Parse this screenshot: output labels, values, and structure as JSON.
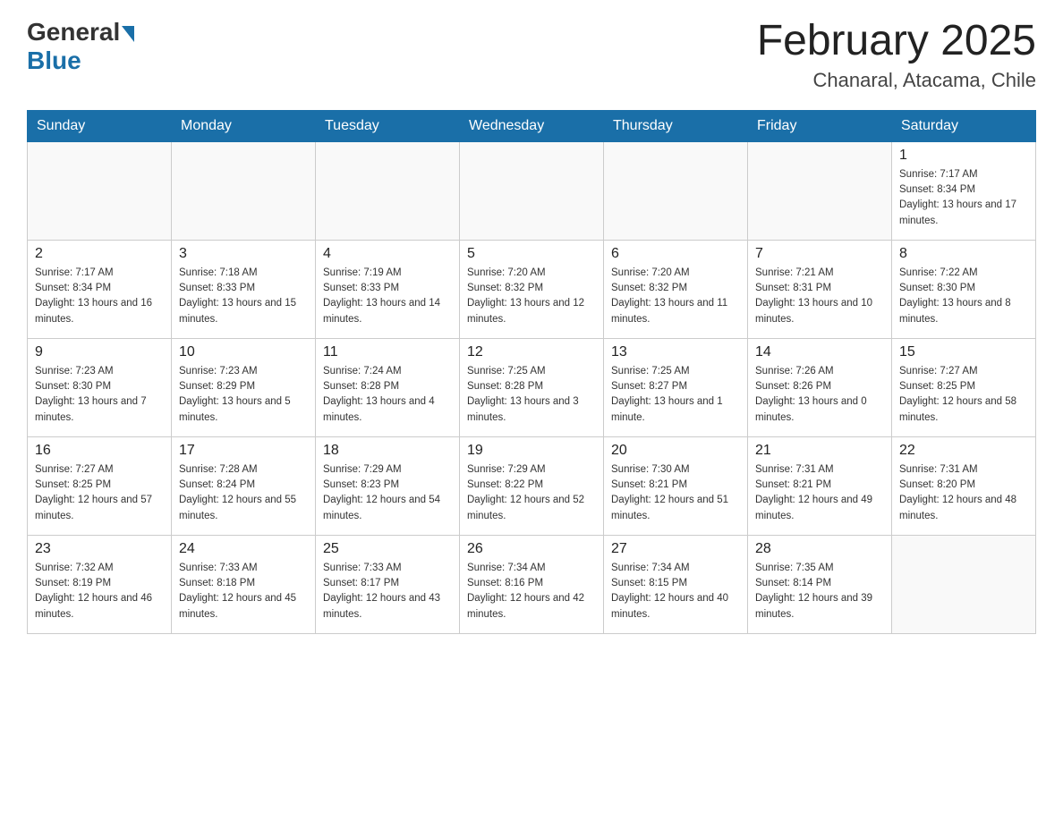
{
  "logo": {
    "general": "General",
    "blue": "Blue"
  },
  "title": "February 2025",
  "subtitle": "Chanaral, Atacama, Chile",
  "days_of_week": [
    "Sunday",
    "Monday",
    "Tuesday",
    "Wednesday",
    "Thursday",
    "Friday",
    "Saturday"
  ],
  "weeks": [
    [
      {
        "day": "",
        "sunrise": "",
        "sunset": "",
        "daylight": ""
      },
      {
        "day": "",
        "sunrise": "",
        "sunset": "",
        "daylight": ""
      },
      {
        "day": "",
        "sunrise": "",
        "sunset": "",
        "daylight": ""
      },
      {
        "day": "",
        "sunrise": "",
        "sunset": "",
        "daylight": ""
      },
      {
        "day": "",
        "sunrise": "",
        "sunset": "",
        "daylight": ""
      },
      {
        "day": "",
        "sunrise": "",
        "sunset": "",
        "daylight": ""
      },
      {
        "day": "1",
        "sunrise": "Sunrise: 7:17 AM",
        "sunset": "Sunset: 8:34 PM",
        "daylight": "Daylight: 13 hours and 17 minutes."
      }
    ],
    [
      {
        "day": "2",
        "sunrise": "Sunrise: 7:17 AM",
        "sunset": "Sunset: 8:34 PM",
        "daylight": "Daylight: 13 hours and 16 minutes."
      },
      {
        "day": "3",
        "sunrise": "Sunrise: 7:18 AM",
        "sunset": "Sunset: 8:33 PM",
        "daylight": "Daylight: 13 hours and 15 minutes."
      },
      {
        "day": "4",
        "sunrise": "Sunrise: 7:19 AM",
        "sunset": "Sunset: 8:33 PM",
        "daylight": "Daylight: 13 hours and 14 minutes."
      },
      {
        "day": "5",
        "sunrise": "Sunrise: 7:20 AM",
        "sunset": "Sunset: 8:32 PM",
        "daylight": "Daylight: 13 hours and 12 minutes."
      },
      {
        "day": "6",
        "sunrise": "Sunrise: 7:20 AM",
        "sunset": "Sunset: 8:32 PM",
        "daylight": "Daylight: 13 hours and 11 minutes."
      },
      {
        "day": "7",
        "sunrise": "Sunrise: 7:21 AM",
        "sunset": "Sunset: 8:31 PM",
        "daylight": "Daylight: 13 hours and 10 minutes."
      },
      {
        "day": "8",
        "sunrise": "Sunrise: 7:22 AM",
        "sunset": "Sunset: 8:30 PM",
        "daylight": "Daylight: 13 hours and 8 minutes."
      }
    ],
    [
      {
        "day": "9",
        "sunrise": "Sunrise: 7:23 AM",
        "sunset": "Sunset: 8:30 PM",
        "daylight": "Daylight: 13 hours and 7 minutes."
      },
      {
        "day": "10",
        "sunrise": "Sunrise: 7:23 AM",
        "sunset": "Sunset: 8:29 PM",
        "daylight": "Daylight: 13 hours and 5 minutes."
      },
      {
        "day": "11",
        "sunrise": "Sunrise: 7:24 AM",
        "sunset": "Sunset: 8:28 PM",
        "daylight": "Daylight: 13 hours and 4 minutes."
      },
      {
        "day": "12",
        "sunrise": "Sunrise: 7:25 AM",
        "sunset": "Sunset: 8:28 PM",
        "daylight": "Daylight: 13 hours and 3 minutes."
      },
      {
        "day": "13",
        "sunrise": "Sunrise: 7:25 AM",
        "sunset": "Sunset: 8:27 PM",
        "daylight": "Daylight: 13 hours and 1 minute."
      },
      {
        "day": "14",
        "sunrise": "Sunrise: 7:26 AM",
        "sunset": "Sunset: 8:26 PM",
        "daylight": "Daylight: 13 hours and 0 minutes."
      },
      {
        "day": "15",
        "sunrise": "Sunrise: 7:27 AM",
        "sunset": "Sunset: 8:25 PM",
        "daylight": "Daylight: 12 hours and 58 minutes."
      }
    ],
    [
      {
        "day": "16",
        "sunrise": "Sunrise: 7:27 AM",
        "sunset": "Sunset: 8:25 PM",
        "daylight": "Daylight: 12 hours and 57 minutes."
      },
      {
        "day": "17",
        "sunrise": "Sunrise: 7:28 AM",
        "sunset": "Sunset: 8:24 PM",
        "daylight": "Daylight: 12 hours and 55 minutes."
      },
      {
        "day": "18",
        "sunrise": "Sunrise: 7:29 AM",
        "sunset": "Sunset: 8:23 PM",
        "daylight": "Daylight: 12 hours and 54 minutes."
      },
      {
        "day": "19",
        "sunrise": "Sunrise: 7:29 AM",
        "sunset": "Sunset: 8:22 PM",
        "daylight": "Daylight: 12 hours and 52 minutes."
      },
      {
        "day": "20",
        "sunrise": "Sunrise: 7:30 AM",
        "sunset": "Sunset: 8:21 PM",
        "daylight": "Daylight: 12 hours and 51 minutes."
      },
      {
        "day": "21",
        "sunrise": "Sunrise: 7:31 AM",
        "sunset": "Sunset: 8:21 PM",
        "daylight": "Daylight: 12 hours and 49 minutes."
      },
      {
        "day": "22",
        "sunrise": "Sunrise: 7:31 AM",
        "sunset": "Sunset: 8:20 PM",
        "daylight": "Daylight: 12 hours and 48 minutes."
      }
    ],
    [
      {
        "day": "23",
        "sunrise": "Sunrise: 7:32 AM",
        "sunset": "Sunset: 8:19 PM",
        "daylight": "Daylight: 12 hours and 46 minutes."
      },
      {
        "day": "24",
        "sunrise": "Sunrise: 7:33 AM",
        "sunset": "Sunset: 8:18 PM",
        "daylight": "Daylight: 12 hours and 45 minutes."
      },
      {
        "day": "25",
        "sunrise": "Sunrise: 7:33 AM",
        "sunset": "Sunset: 8:17 PM",
        "daylight": "Daylight: 12 hours and 43 minutes."
      },
      {
        "day": "26",
        "sunrise": "Sunrise: 7:34 AM",
        "sunset": "Sunset: 8:16 PM",
        "daylight": "Daylight: 12 hours and 42 minutes."
      },
      {
        "day": "27",
        "sunrise": "Sunrise: 7:34 AM",
        "sunset": "Sunset: 8:15 PM",
        "daylight": "Daylight: 12 hours and 40 minutes."
      },
      {
        "day": "28",
        "sunrise": "Sunrise: 7:35 AM",
        "sunset": "Sunset: 8:14 PM",
        "daylight": "Daylight: 12 hours and 39 minutes."
      },
      {
        "day": "",
        "sunrise": "",
        "sunset": "",
        "daylight": ""
      }
    ]
  ]
}
